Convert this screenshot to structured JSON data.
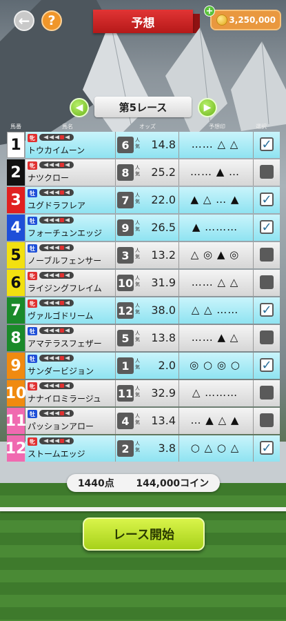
{
  "header": {
    "title": "予想",
    "coins": "3,250,000",
    "back_icon": "←",
    "help_icon": "?",
    "plus_icon": "+"
  },
  "race": {
    "title": "第5レース",
    "prev_icon": "◀",
    "next_icon": "▶"
  },
  "columns": {
    "number": "馬番",
    "name": "馬名",
    "odds": "オッズ",
    "prediction": "予想印",
    "select": "選択"
  },
  "popularity_label": "人気",
  "rows": [
    {
      "num": "1",
      "sex": "牝",
      "name": "トウカイムーン",
      "pop": "6",
      "odds": "14.8",
      "pred": "…… △ △",
      "selected": true,
      "hl": true
    },
    {
      "num": "2",
      "sex": "牝",
      "name": "ナツクロー",
      "pop": "8",
      "odds": "25.2",
      "pred": "…… ▲ …",
      "selected": false,
      "hl": false
    },
    {
      "num": "3",
      "sex": "牡",
      "name": "ユグドラフレア",
      "pop": "7",
      "odds": "22.0",
      "pred": "▲ △ … ▲",
      "selected": true,
      "hl": true
    },
    {
      "num": "4",
      "sex": "牡",
      "name": "フォーチュンエッジ",
      "pop": "9",
      "odds": "26.5",
      "pred": "▲ ………",
      "selected": true,
      "hl": true
    },
    {
      "num": "5",
      "sex": "牡",
      "name": "ノーブルフェンサー",
      "pop": "3",
      "odds": "13.2",
      "pred": "△ ◎ ▲ ◎",
      "selected": false,
      "hl": false
    },
    {
      "num": "6",
      "sex": "牝",
      "name": "ライジングフレイム",
      "pop": "10",
      "odds": "31.9",
      "pred": "…… △ △",
      "selected": false,
      "hl": false
    },
    {
      "num": "7",
      "sex": "牝",
      "name": "ヴァルゴドリーム",
      "pop": "12",
      "odds": "38.0",
      "pred": "△ △ ……",
      "selected": true,
      "hl": true
    },
    {
      "num": "8",
      "sex": "牡",
      "name": "アマテラスフェザー",
      "pop": "5",
      "odds": "13.8",
      "pred": "…… ▲ △",
      "selected": false,
      "hl": false
    },
    {
      "num": "9",
      "sex": "牡",
      "name": "サンダービジョン",
      "pop": "1",
      "odds": "2.0",
      "pred": "◎ ○ ◎ ○",
      "selected": true,
      "hl": true
    },
    {
      "num": "10",
      "sex": "牝",
      "name": "ナナイロミラージュ",
      "pop": "11",
      "odds": "32.9",
      "pred": "△ ………",
      "selected": false,
      "hl": false
    },
    {
      "num": "11",
      "sex": "牡",
      "name": "パッションアロー",
      "pop": "4",
      "odds": "13.4",
      "pred": "… ▲ △ ▲",
      "selected": false,
      "hl": false
    },
    {
      "num": "12",
      "sex": "牝",
      "name": "ストームエッジ",
      "pop": "2",
      "odds": "3.8",
      "pred": "○ △ ○ △",
      "selected": true,
      "hl": true
    }
  ],
  "gate_colors": [
    "#ffffff",
    "#111111",
    "#e02020",
    "#1e4fd8",
    "#f2e010",
    "#f2e010",
    "#1a8a2a",
    "#1a8a2a",
    "#f08a10",
    "#f08a10",
    "#f06ab0",
    "#f06ab0"
  ],
  "gate_text_colors": [
    "#111",
    "#fff",
    "#fff",
    "#fff",
    "#111",
    "#111",
    "#fff",
    "#fff",
    "#fff",
    "#fff",
    "#fff",
    "#fff"
  ],
  "totals": {
    "points": "1440点",
    "coins": "144,000コイン"
  },
  "start_button": "レース開始"
}
